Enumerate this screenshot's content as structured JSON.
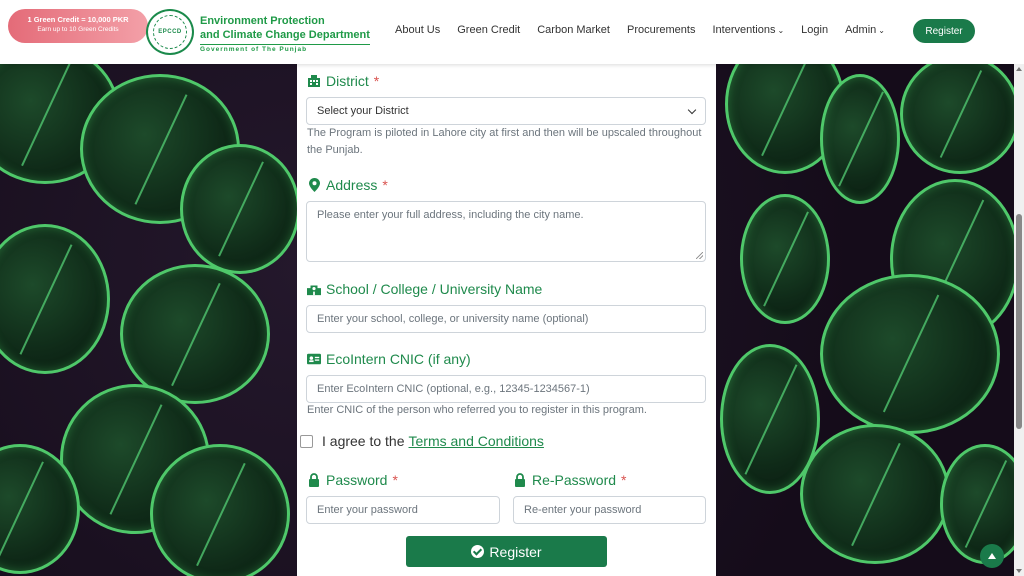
{
  "header": {
    "credit_badge": {
      "line1": "1 Green Credit = 10,000 PKR",
      "line2": "Earn up to 10 Green Credits"
    },
    "logo_text": "EPCCD",
    "brand_line1": "Environment Protection",
    "brand_line2": "and Climate Change Department",
    "brand_line3": "Government of The Punjab",
    "nav": [
      {
        "label": "About Us"
      },
      {
        "label": "Green Credit"
      },
      {
        "label": "Carbon Market"
      },
      {
        "label": "Procurements"
      },
      {
        "label": "Interventions"
      },
      {
        "label": "Login"
      },
      {
        "label": "Admin"
      }
    ],
    "register_label": "Register"
  },
  "form": {
    "district": {
      "label": "District",
      "required": "*",
      "value": "Select your District",
      "help": "The Program is piloted in Lahore city at first and then will be upscaled throughout the Punjab."
    },
    "address": {
      "label": "Address",
      "required": "*",
      "placeholder": "Please enter your full address, including the city name."
    },
    "school": {
      "label": "School / College / University Name",
      "placeholder": "Enter your school, college, or university name (optional)"
    },
    "cnic": {
      "label": "EcoIntern CNIC (if any)",
      "placeholder": "Enter EcoIntern CNIC (optional, e.g., 12345-1234567-1)",
      "help": "Enter CNIC of the person who referred you to register in this program."
    },
    "terms": {
      "prefix": "I agree to the",
      "link": "Terms and Conditions"
    },
    "password": {
      "label": "Password",
      "required": "*",
      "placeholder": "Enter your password"
    },
    "repassword": {
      "label": "Re-Password",
      "required": "*",
      "placeholder": "Re-enter your password"
    },
    "submit_label": "Register"
  },
  "colors": {
    "brand_green": "#1f8a4c",
    "button_green": "#1a7a4a",
    "badge_pink": "#e46b78",
    "required_red": "#d9534f"
  }
}
